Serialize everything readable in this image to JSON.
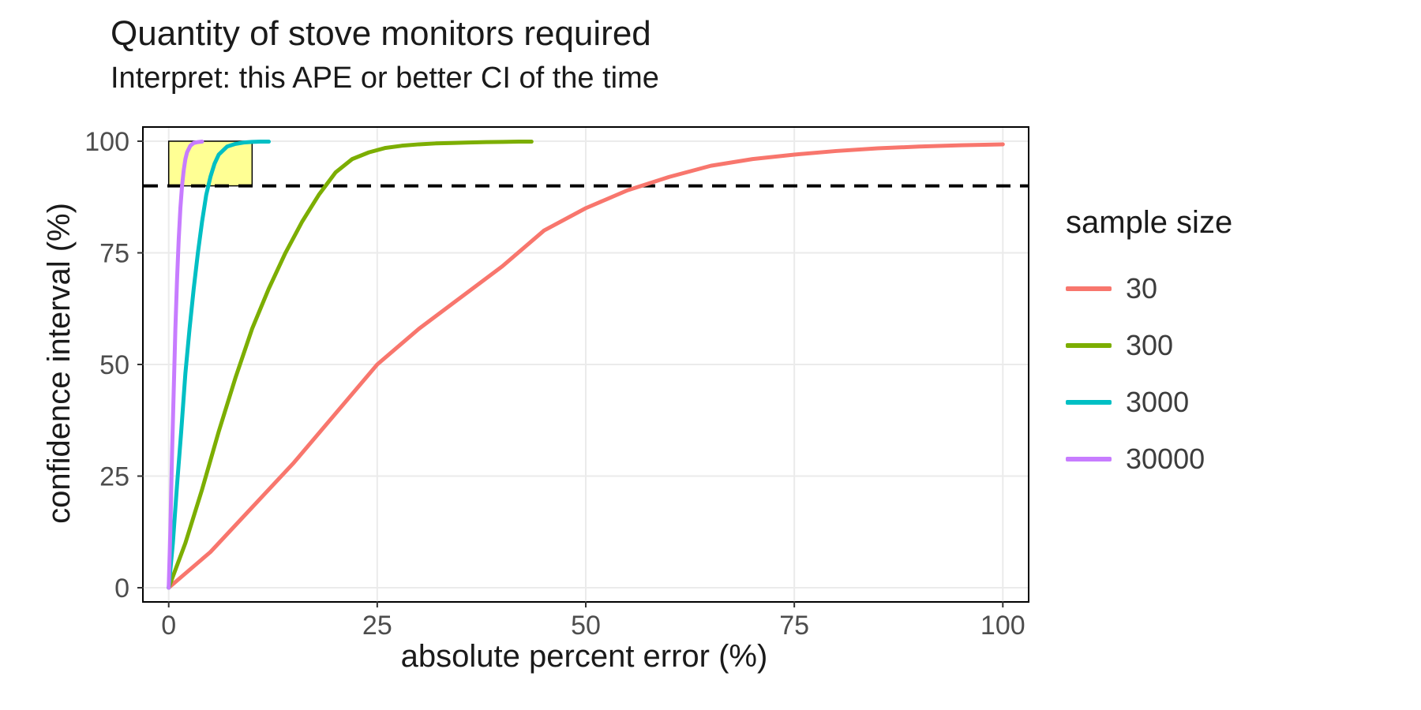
{
  "chart_data": {
    "type": "line",
    "title": "Quantity of stove monitors required",
    "subtitle": "Interpret: this APE or better CI of the time",
    "xlabel": "absolute percent error (%)",
    "ylabel": "confidence interval (%)",
    "xlim": [
      -3,
      103
    ],
    "ylim": [
      -3,
      103
    ],
    "xticks": [
      0,
      25,
      50,
      75,
      100
    ],
    "yticks": [
      0,
      25,
      50,
      75,
      100
    ],
    "hline": 90,
    "highlight_rect": {
      "x0": 0,
      "y0": 90,
      "x1": 10,
      "y1": 100
    },
    "legend_title": "sample size",
    "series": [
      {
        "name": "30",
        "color": "#F8766D",
        "x": [
          0,
          5,
          10,
          15,
          20,
          25,
          30,
          35,
          40,
          45,
          50,
          55,
          60,
          65,
          70,
          75,
          80,
          85,
          90,
          95,
          100
        ],
        "y": [
          0,
          8,
          18,
          28,
          39,
          50,
          58,
          65,
          72,
          80,
          85,
          89,
          92,
          94.5,
          96,
          97,
          97.8,
          98.4,
          98.8,
          99.1,
          99.3
        ]
      },
      {
        "name": "300",
        "color": "#7CAE00",
        "x": [
          0,
          2,
          4,
          6,
          8,
          10,
          12,
          14,
          16,
          18,
          20,
          22,
          24,
          26,
          28,
          30,
          32,
          34,
          36,
          38,
          40,
          42,
          43.5
        ],
        "y": [
          0,
          10,
          22,
          35,
          47,
          58,
          67,
          75,
          82,
          88,
          93,
          96,
          97.5,
          98.5,
          99,
          99.3,
          99.5,
          99.6,
          99.7,
          99.8,
          99.85,
          99.9,
          99.9
        ]
      },
      {
        "name": "3000",
        "color": "#00BFC4",
        "x": [
          0,
          0.5,
          1,
          1.5,
          2,
          2.5,
          3,
          3.5,
          4,
          4.5,
          5,
          5.5,
          6,
          7,
          8,
          9,
          10,
          11,
          12
        ],
        "y": [
          0,
          10,
          23,
          35,
          48,
          58,
          67,
          75,
          82,
          88,
          92,
          95,
          97,
          98.8,
          99.4,
          99.7,
          99.85,
          99.9,
          99.9
        ]
      },
      {
        "name": "30000",
        "color": "#C77CFF",
        "x": [
          0,
          0.2,
          0.4,
          0.6,
          0.8,
          1,
          1.2,
          1.4,
          1.6,
          1.8,
          2,
          2.2,
          2.6,
          3,
          3.5,
          4
        ],
        "y": [
          0,
          13,
          30,
          44,
          58,
          69,
          78,
          85,
          90,
          93.5,
          96,
          97.5,
          99,
          99.6,
          99.8,
          99.9
        ]
      }
    ]
  }
}
